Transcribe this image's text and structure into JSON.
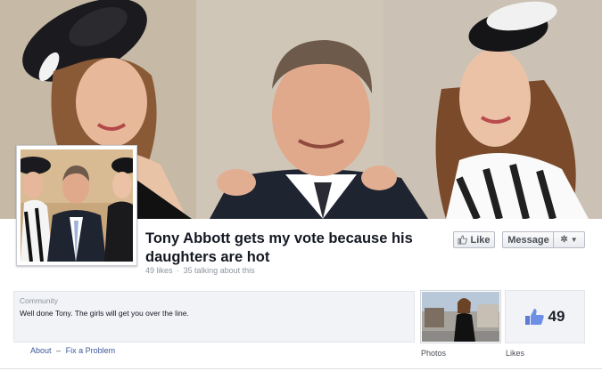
{
  "page": {
    "title": "Tony Abbott gets my vote because his daughters are hot",
    "likes_text": "49 likes",
    "separator": "·",
    "talking_text": "35 talking about this"
  },
  "actions": {
    "like_label": "Like",
    "message_label": "Message",
    "gear_icon": "gear-icon",
    "caret": "▼"
  },
  "about": {
    "category": "Community",
    "description": "Well done Tony. The girls will get you over the line."
  },
  "sidebar": {
    "photos_label": "Photos",
    "likes_label": "Likes",
    "likes_count": "49"
  },
  "footer": {
    "about_link": "About",
    "separator": "–",
    "fix_link": "Fix a Problem"
  },
  "colors": {
    "link": "#3b5998",
    "muted": "#8d949e",
    "panel": "#f2f3f6"
  }
}
